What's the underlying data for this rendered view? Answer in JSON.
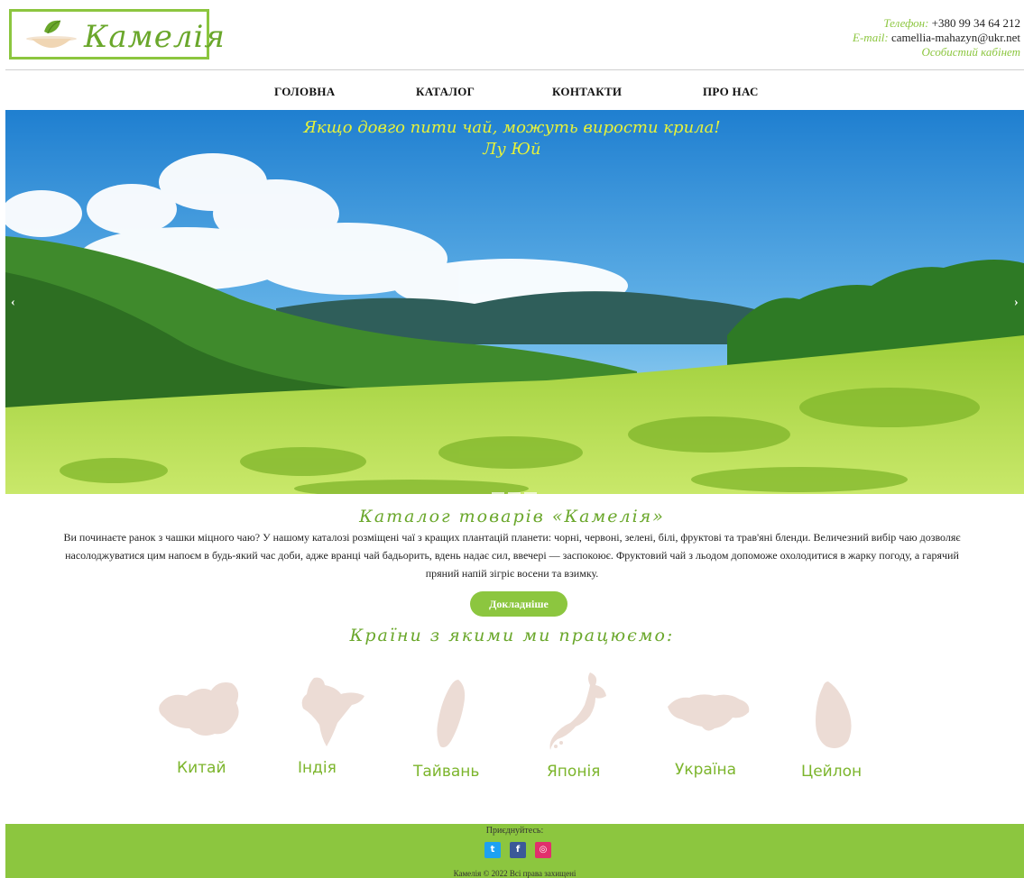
{
  "header": {
    "logo_text": "Камелія",
    "phone_label": "Телефон:",
    "phone": "+380 99 34 64 212",
    "email_label": "E-mail:",
    "email": "camellia-mahazyn@ukr.net",
    "account": "Особистий кабінет"
  },
  "nav": [
    {
      "label": "ГОЛОВНА"
    },
    {
      "label": "КАТАЛОГ"
    },
    {
      "label": "КОНТАКТИ"
    },
    {
      "label": "ПРО НАС"
    }
  ],
  "hero": {
    "quote": "Якщо довго пити чай, можуть вирости крила!",
    "author": "Лу Юй",
    "prev": "‹",
    "next": "›"
  },
  "catalog": {
    "title": "Каталог товарів «Камелія»",
    "line1": "Ви починаєте ранок з чашки міцного чаю? У нашому каталозі розміщені чаї з кращих плантацій планети: чорні, червоні, зелені, білі, фруктові та трав'яні бленди. Величезний вибір чаю дозволяє",
    "line2": "насолоджуватися цим напоєм в будь-який час доби, адже вранці чай бадьорить, вдень надає сил, ввечері — заспокоює. Фруктовий чай з льодом допоможе охолодитися в жарку погоду, а гарячий",
    "line3": "пряний напій зігріє восени та взимку.",
    "button": "Докладніше"
  },
  "countries": {
    "title": "Країни з якими ми працюємо:",
    "items": [
      {
        "name": "Китай"
      },
      {
        "name": "Індія"
      },
      {
        "name": "Тайвань"
      },
      {
        "name": "Японія"
      },
      {
        "name": "Україна"
      },
      {
        "name": "Цейлон"
      }
    ]
  },
  "footer": {
    "join": "Приєднуйтесь:",
    "copyright": "Камелія © 2022 Всі права захищені"
  },
  "colors": {
    "accent": "#8cc63f",
    "accent_dark": "#6aa72b",
    "map_fill": "#ecdcd5",
    "quote": "#e6f23a"
  }
}
